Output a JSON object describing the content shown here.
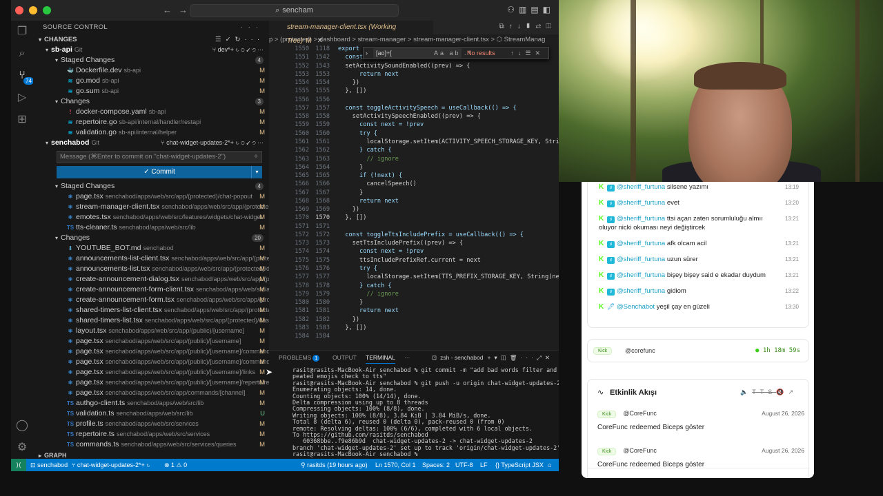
{
  "titlebar": {
    "search": "sencham"
  },
  "activitybar": {
    "scm_badge": "74"
  },
  "sidebar": {
    "header": "SOURCE CONTROL",
    "changes_header": "CHANGES",
    "repo1": {
      "name": "sb-api",
      "kind": "Git",
      "branch": "dev*+"
    },
    "repo1_staged": {
      "label": "Staged Changes",
      "count": "4"
    },
    "repo1_staged_files": [
      {
        "name": "Dockerfile.dev",
        "path": "sb-api",
        "status": "M",
        "type": "dock"
      },
      {
        "name": "go.mod",
        "path": "sb-api",
        "status": "M",
        "type": "go"
      },
      {
        "name": "go.sum",
        "path": "sb-api",
        "status": "M",
        "type": "go"
      }
    ],
    "repo1_changes": {
      "label": "Changes",
      "count": "3"
    },
    "repo1_change_files": [
      {
        "name": "docker-compose.yaml",
        "path": "sb-api",
        "status": "M",
        "type": "yaml"
      },
      {
        "name": "repertoire.go",
        "path": "sb-api/internal/handler/restapi",
        "status": "M",
        "type": "go"
      },
      {
        "name": "validation.go",
        "path": "sb-api/internal/helper",
        "status": "M",
        "type": "go"
      }
    ],
    "repo2": {
      "name": "senchabod",
      "kind": "Git",
      "branch": "chat-widget-updates-2*+"
    },
    "commit_placeholder": "Message (⌘Enter to commit on \"chat-widget-updates-2\")",
    "commit_label": "✓ Commit",
    "repo2_staged": {
      "label": "Staged Changes",
      "count": "4"
    },
    "repo2_staged_files": [
      {
        "name": "page.tsx",
        "path": "senchabod/apps/web/src/app/(protected)/chat-popout",
        "status": "M",
        "type": "tsx"
      },
      {
        "name": "stream-manager-client.tsx",
        "path": "senchabod/apps/web/src/app/(protected)/da...",
        "status": "M",
        "type": "tsx"
      },
      {
        "name": "emotes.tsx",
        "path": "senchabod/apps/web/src/features/widgets/chat-widget",
        "status": "M",
        "type": "tsx"
      },
      {
        "name": "tts-cleaner.ts",
        "path": "senchabod/apps/web/src/lib",
        "status": "M",
        "type": "ts"
      }
    ],
    "repo2_changes": {
      "label": "Changes",
      "count": "20"
    },
    "repo2_change_files": [
      {
        "name": "YOUTUBE_BOT.md",
        "path": "senchabod",
        "status": "M",
        "type": "md"
      },
      {
        "name": "announcements-list-client.tsx",
        "path": "senchabod/apps/web/src/app/(protected)/...",
        "status": "M",
        "type": "tsx"
      },
      {
        "name": "announcements-list.tsx",
        "path": "senchabod/apps/web/src/app/(protected)/dashb...",
        "status": "M",
        "type": "tsx"
      },
      {
        "name": "create-announcement-dialog.tsx",
        "path": "senchabod/apps/web/src/app/(protect...",
        "status": "M",
        "type": "tsx"
      },
      {
        "name": "create-announcement-form-client.tsx",
        "path": "senchabod/apps/web/src/app/(pro...",
        "status": "M",
        "type": "tsx"
      },
      {
        "name": "create-announcement-form.tsx",
        "path": "senchabod/apps/web/src/app/(protecte...",
        "status": "M",
        "type": "tsx"
      },
      {
        "name": "shared-timers-list-client.tsx",
        "path": "senchabod/apps/web/src/app/(protected)/d...",
        "status": "M",
        "type": "tsx"
      },
      {
        "name": "shared-timers-list.tsx",
        "path": "senchabod/apps/web/src/app/(protected)/dashboa...",
        "status": "M",
        "type": "tsx"
      },
      {
        "name": "layout.tsx",
        "path": "senchabod/apps/web/src/app/(public)/[username]",
        "status": "M",
        "type": "tsx"
      },
      {
        "name": "page.tsx",
        "path": "senchabod/apps/web/src/app/(public)/[username]",
        "status": "M",
        "type": "tsx"
      },
      {
        "name": "page.tsx",
        "path": "senchabod/apps/web/src/app/(public)/[username]/commands",
        "status": "M",
        "type": "tsx"
      },
      {
        "name": "page.tsx",
        "path": "senchabod/apps/web/src/app/(public)/[username]/commands/[pl...",
        "status": "M",
        "type": "tsx"
      },
      {
        "name": "page.tsx",
        "path": "senchabod/apps/web/src/app/(public)/[username]/links",
        "status": "M",
        "type": "tsx"
      },
      {
        "name": "page.tsx",
        "path": "senchabod/apps/web/src/app/(public)/[username]/repertoire",
        "status": "M",
        "type": "tsx"
      },
      {
        "name": "page.tsx",
        "path": "senchabod/apps/web/src/app/commands/[channel]",
        "status": "M",
        "type": "tsx"
      },
      {
        "name": "authgo-client.ts",
        "path": "senchabod/apps/web/src/lib",
        "status": "M",
        "type": "ts"
      },
      {
        "name": "validation.ts",
        "path": "senchabod/apps/web/src/lib",
        "status": "U",
        "type": "ts"
      },
      {
        "name": "profile.ts",
        "path": "senchabod/apps/web/src/services",
        "status": "M",
        "type": "ts"
      },
      {
        "name": "repertoire.ts",
        "path": "senchabod/apps/web/src/services",
        "status": "M",
        "type": "ts"
      },
      {
        "name": "commands.ts",
        "path": "senchabod/apps/web/src/services/queries",
        "status": "M",
        "type": "ts"
      }
    ],
    "graph": "GRAPH"
  },
  "editor": {
    "tab_title": "stream-manager-client.tsx (Working Tree)",
    "tab_status": "M",
    "breadcrumbs": "p > (protected) > dashboard > stream-manager > stream-manager-client.tsx > ⬡ StreamManag",
    "find": {
      "query": "[ao]+[",
      "options": "Aa ab .*",
      "result": "No results"
    },
    "lines": [
      {
        "a": "1550",
        "b": "1118",
        "code": "export "
      },
      {
        "a": "1551",
        "b": "1542",
        "code": "  const "
      },
      {
        "a": "1552",
        "b": "1543",
        "code": "  setActivitySoundEnabled((prev) => {"
      },
      {
        "a": "1553",
        "b": "1553",
        "code": "      return next"
      },
      {
        "a": "1554",
        "b": "1554",
        "code": "    })"
      },
      {
        "a": "1555",
        "b": "1555",
        "code": "  }, [])"
      },
      {
        "a": "1556",
        "b": "1556",
        "code": ""
      },
      {
        "a": "1557",
        "b": "1557",
        "code": "  const toggleActivitySpeech = useCallback(() => {"
      },
      {
        "a": "1558",
        "b": "1558",
        "code": "    setActivitySpeechEnabled((prev) => {"
      },
      {
        "a": "1559",
        "b": "1559",
        "code": "      const next = !prev"
      },
      {
        "a": "1560",
        "b": "1560",
        "code": "      try {"
      },
      {
        "a": "1561",
        "b": "1561",
        "code": "        localStorage.setItem(ACTIVITY_SPEECH_STORAGE_KEY, String(ne"
      },
      {
        "a": "1562",
        "b": "1562",
        "code": "      } catch {"
      },
      {
        "a": "1563",
        "b": "1563",
        "code": "        // ignore"
      },
      {
        "a": "1564",
        "b": "1564",
        "code": "      }"
      },
      {
        "a": "1565",
        "b": "1565",
        "code": "      if (!next) {"
      },
      {
        "a": "1566",
        "b": "1566",
        "code": "        cancelSpeech()"
      },
      {
        "a": "1567",
        "b": "1567",
        "code": "      }"
      },
      {
        "a": "1568",
        "b": "1568",
        "code": "      return next"
      },
      {
        "a": "1569",
        "b": "1569",
        "code": "    })"
      },
      {
        "a": "1570",
        "b": "1570",
        "code": "  }, [])"
      },
      {
        "a": "1571",
        "b": "1571",
        "code": ""
      },
      {
        "a": "1572",
        "b": "1572",
        "code": "  const toggleTtsIncludePrefix = useCallback(() => {"
      },
      {
        "a": "1573",
        "b": "1573",
        "code": "    setTtsIncludePrefix((prev) => {"
      },
      {
        "a": "1574",
        "b": "1574",
        "code": "      const next = !prev"
      },
      {
        "a": "1575",
        "b": "1575",
        "code": "      ttsIncludePrefixRef.current = next"
      },
      {
        "a": "1576",
        "b": "1576",
        "code": "      try {"
      },
      {
        "a": "1577",
        "b": "1577",
        "code": "        localStorage.setItem(TTS_PREFIX_STORAGE_KEY, String(next))"
      },
      {
        "a": "1578",
        "b": "1578",
        "code": "      } catch {"
      },
      {
        "a": "1579",
        "b": "1579",
        "code": "        // ignore"
      },
      {
        "a": "1580",
        "b": "1580",
        "code": "      }"
      },
      {
        "a": "1581",
        "b": "1581",
        "code": "      return next"
      },
      {
        "a": "1582",
        "b": "1582",
        "code": "    })"
      },
      {
        "a": "1583",
        "b": "1583",
        "code": "  }, [])"
      },
      {
        "a": "1584",
        "b": "1584",
        "code": ""
      }
    ]
  },
  "panel": {
    "tabs": [
      "PROBLEMS",
      "OUTPUT",
      "TERMINAL",
      "···"
    ],
    "problems_badge": "1",
    "terminal_name": "zsh - senchabod",
    "terminal_lines": [
      "rasit@rasits-MacBook-Air senchabod % git commit -m \"add bad words filter and re",
      "peated emojis check to tts\"",
      "rasit@rasits-MacBook-Air senchabod % git push -u origin chat-widget-updates-2",
      "Enumerating objects: 14, done.",
      "Counting objects: 100% (14/14), done.",
      "Delta compression using up to 8 threads",
      "Compressing objects: 100% (8/8), done.",
      "Writing objects: 100% (8/8), 3.84 KiB | 3.84 MiB/s, done.",
      "Total 8 (delta 6), reused 0 (delta 0), pack-reused 0 (from 0)",
      "remote: Resolving deltas: 100% (6/6), completed with 6 local objects.",
      "To https://github.com/rasitds/senchabod",
      "   60368bbe..f9e86b9d  chat-widget-updates-2 -> chat-widget-updates-2",
      "branch 'chat-widget-updates-2' set up to track 'origin/chat-widget-updates-2'.",
      "rasit@rasits-MacBook-Air senchabod % "
    ]
  },
  "statusbar": {
    "repo": "senchabod",
    "branch": "chat-widget-updates-2*+",
    "problems": "⊗ 1 ⚠ 0",
    "blame": "rasitds (19 hours ago)",
    "position": "Ln 1570, Col 1",
    "spaces": "Spaces: 2",
    "encoding": "UTF-8",
    "eol": "LF",
    "language": "TypeScript JSX"
  },
  "chat": {
    "messages": [
      {
        "user": "@sheriff_furtuna",
        "text": "silsene yazımı",
        "time": "13:19"
      },
      {
        "user": "@sheriff_furtuna",
        "text": "evet",
        "time": "13:20"
      },
      {
        "user": "@sheriff_furtuna",
        "text": "ttsi açan zaten sorumluluğu almıı oluyor nicki okuması neyi değiştircek",
        "time": "13:21"
      },
      {
        "user": "@sheriff_furtuna",
        "text": "afk olcam acil",
        "time": "13:21"
      },
      {
        "user": "@sheriff_furtuna",
        "text": "uzun sürer",
        "time": "13:21"
      },
      {
        "user": "@sheriff_furtuna",
        "text": "bişey bişey said e ekadar duydum",
        "time": "13:21"
      },
      {
        "user": "@sheriff_furtuna",
        "text": "gidiom",
        "time": "13:22"
      },
      {
        "user": "@Senchabot",
        "text": "yeşil çay en güzeli",
        "time": "13:30",
        "bot": true
      }
    ],
    "live": {
      "platform": "Kick",
      "user": "@corefunc",
      "uptime": "1h 18m 59s"
    },
    "activity": {
      "title": "Etkinlik Akışı",
      "tts": "TTS",
      "events": [
        {
          "platform": "Kick",
          "user": "@CoreFunc",
          "date": "August 26, 2026",
          "text": "CoreFunc redeemed Biceps göster"
        },
        {
          "platform": "Kick",
          "user": "@CoreFunc",
          "date": "August 26, 2026",
          "text": "CoreFunc redeemed Biceps göster"
        }
      ]
    }
  }
}
